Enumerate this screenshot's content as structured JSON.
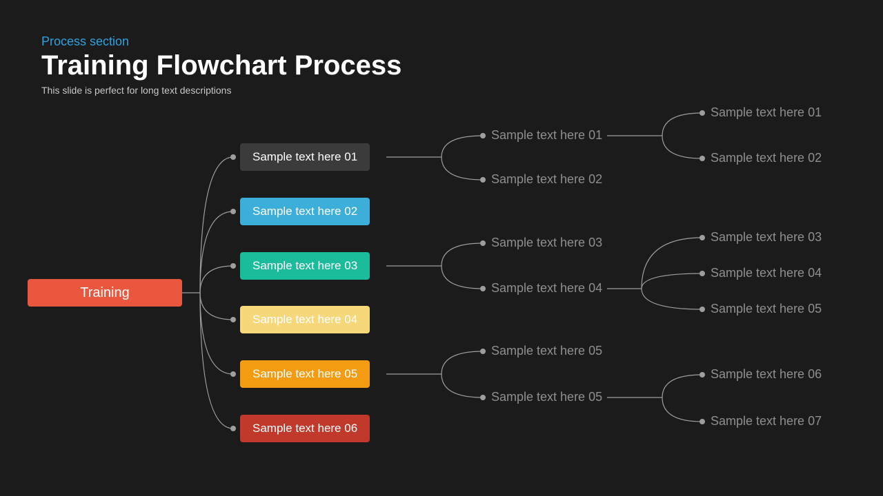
{
  "header": {
    "eyebrow": "Process section",
    "title": "Training Flowchart Process",
    "sub": "This slide is perfect for long text descriptions"
  },
  "root": {
    "label": "Training"
  },
  "level1": [
    {
      "label": "Sample text here 01"
    },
    {
      "label": "Sample text here 02"
    },
    {
      "label": "Sample text here 03"
    },
    {
      "label": "Sample text here 04"
    },
    {
      "label": "Sample text here 05"
    },
    {
      "label": "Sample text here 06"
    }
  ],
  "branchA": [
    {
      "label": "Sample text here 01"
    },
    {
      "label": "Sample text here 02"
    }
  ],
  "branchB": [
    {
      "label": "Sample text here 03"
    },
    {
      "label": "Sample text here 04"
    }
  ],
  "branchC": [
    {
      "label": "Sample text here 05"
    },
    {
      "label": "Sample text here 05"
    }
  ],
  "leafA": [
    {
      "label": "Sample text here 01"
    },
    {
      "label": "Sample text here 02"
    }
  ],
  "leafB": [
    {
      "label": "Sample text here 03"
    },
    {
      "label": "Sample text here 04"
    },
    {
      "label": "Sample text here 05"
    }
  ],
  "leafC": [
    {
      "label": "Sample text here 06"
    },
    {
      "label": "Sample text here 07"
    }
  ],
  "chart_data": {
    "type": "tree",
    "title": "Training Flowchart Process",
    "root": "Training",
    "children": [
      {
        "label": "Sample text here 01",
        "color": "#3b3b3b",
        "children": [
          {
            "label": "Sample text here 01",
            "children": [
              {
                "label": "Sample text here 01"
              },
              {
                "label": "Sample text here 02"
              }
            ]
          },
          {
            "label": "Sample text here 02"
          }
        ]
      },
      {
        "label": "Sample text here 02",
        "color": "#3bafda"
      },
      {
        "label": "Sample text here 03",
        "color": "#1abc9c",
        "children": [
          {
            "label": "Sample text here 03"
          },
          {
            "label": "Sample text here 04",
            "children": [
              {
                "label": "Sample text here 03"
              },
              {
                "label": "Sample text here 04"
              },
              {
                "label": "Sample text here 05"
              }
            ]
          }
        ]
      },
      {
        "label": "Sample text here 04",
        "color": "#f6d77a"
      },
      {
        "label": "Sample text here 05",
        "color": "#f39c12",
        "children": [
          {
            "label": "Sample text here 05"
          },
          {
            "label": "Sample text here 05",
            "children": [
              {
                "label": "Sample text here 06"
              },
              {
                "label": "Sample text here 07"
              }
            ]
          }
        ]
      },
      {
        "label": "Sample text here 06",
        "color": "#c0392b"
      }
    ]
  }
}
